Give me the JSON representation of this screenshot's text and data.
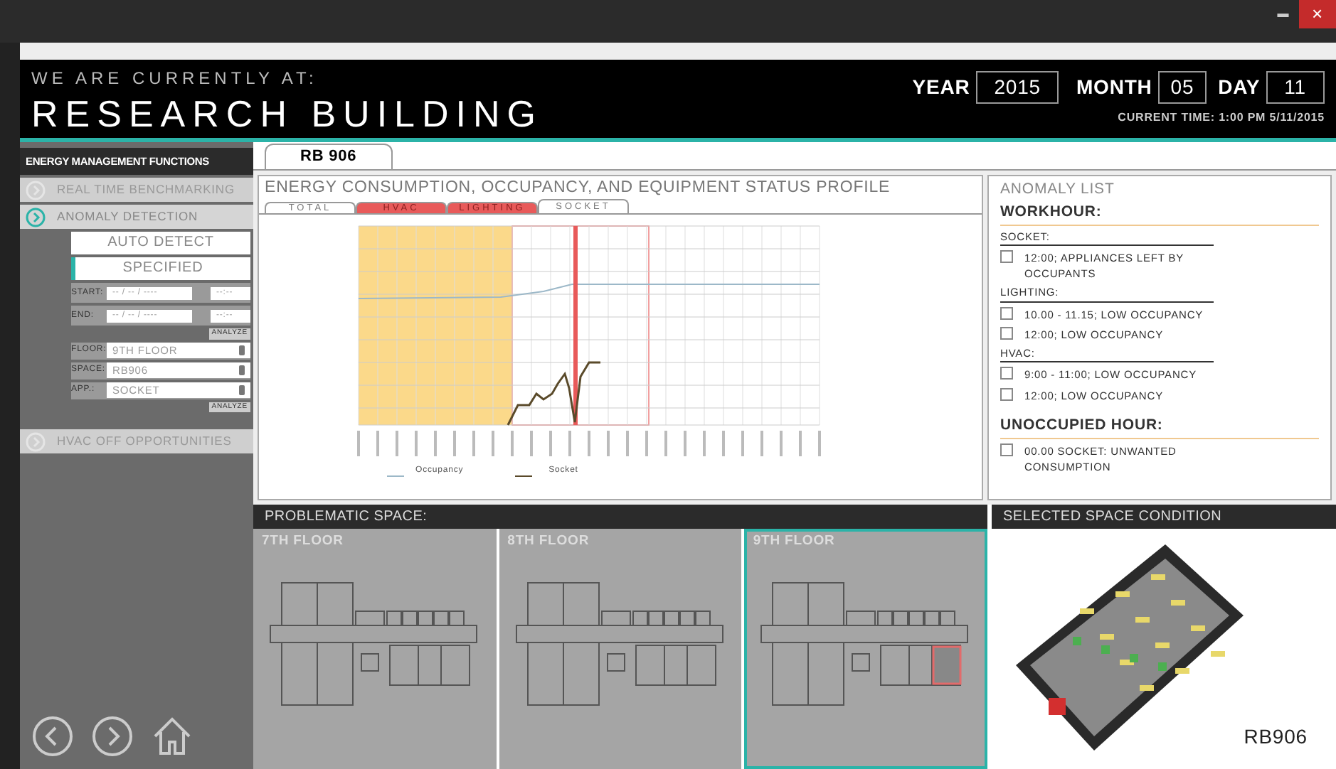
{
  "window": {
    "controls": [
      "▬",
      "×"
    ]
  },
  "header": {
    "subtitle": "WE ARE CURRENTLY AT:",
    "title": "RESEARCH BUILDING",
    "year_label": "YEAR",
    "year": "2015",
    "month_label": "MONTH",
    "month": "05",
    "day_label": "DAY",
    "day": "11",
    "current_time": "CURRENT TIME: 1:00 PM 5/11/2015"
  },
  "sidebar": {
    "title": "ENERGY MANAGEMENT FUNCTIONS",
    "functions": [
      {
        "label": "REAL TIME BENCHMARKING",
        "expanded": false
      },
      {
        "label": "ANOMALY DETECTION",
        "expanded": true
      },
      {
        "label": "HVAC OFF OPPORTUNITIES",
        "expanded": false
      }
    ],
    "modes": [
      {
        "label": "AUTO DETECT",
        "selected": false
      },
      {
        "label": "SPECIFIED",
        "selected": true
      }
    ],
    "range": [
      {
        "label": "START:",
        "date": "-- / -- / ----",
        "time": "--:--"
      },
      {
        "label": "END:",
        "date": "-- / -- / ----",
        "time": "--:--"
      }
    ],
    "analyze_buttons": [
      "ANALYZE",
      "ANALYZE"
    ],
    "selects": [
      {
        "label": "FLOOR:",
        "value": "9TH FLOOR"
      },
      {
        "label": "SPACE:",
        "value": "RB906"
      },
      {
        "label": "APP.:",
        "value": "SOCKET"
      }
    ]
  },
  "tabs": [
    {
      "label": "RB 906",
      "selected": true
    }
  ],
  "profile": {
    "title": "ENERGY CONSUMPTION, OCCUPANCY, AND EQUIPMENT STATUS PROFILE",
    "tabs": [
      {
        "label": "TOTAL",
        "selected": false,
        "alert": false
      },
      {
        "label": "HVAC",
        "selected": false,
        "alert": true
      },
      {
        "label": "LIGHTING",
        "selected": false,
        "alert": true
      },
      {
        "label": "SOCKET",
        "selected": true,
        "alert": false
      }
    ],
    "legend": [
      "Occupancy",
      "Socket"
    ]
  },
  "anomaly_list": {
    "title": "ANOMALY LIST",
    "sections": [
      {
        "title": "WORKHOUR:",
        "groups": [
          {
            "title": "SOCKET:",
            "items": [
              {
                "text": "12:00; APPLIANCES LEFT BY OCCUPANTS",
                "checked": false
              }
            ]
          },
          {
            "title": "LIGHTING:",
            "items": [
              {
                "text": "10.00 - 11.15; LOW OCCUPANCY",
                "checked": false
              },
              {
                "text": "12:00; LOW OCCUPANCY",
                "checked": false
              }
            ]
          },
          {
            "title": "HVAC:",
            "items": [
              {
                "text": "9:00 - 11:00; LOW OCCUPANCY",
                "checked": false
              },
              {
                "text": "12:00; LOW OCCUPANCY",
                "checked": false
              }
            ]
          }
        ]
      },
      {
        "title": "UNOCCUPIED HOUR:",
        "groups": [
          {
            "items": [
              {
                "text": "00.00 SOCKET: UNWANTED CONSUMPTION",
                "checked": false
              }
            ]
          }
        ]
      }
    ]
  },
  "problematic_space": {
    "title": "PROBLEMATIC SPACE:",
    "floors": [
      {
        "label": "7TH FLOOR",
        "selected": false
      },
      {
        "label": "8TH FLOOR",
        "selected": false
      },
      {
        "label": "9TH FLOOR",
        "selected": true
      }
    ]
  },
  "space_condition": {
    "title": "SELECTED SPACE CONDITION",
    "room": "RB906"
  }
}
